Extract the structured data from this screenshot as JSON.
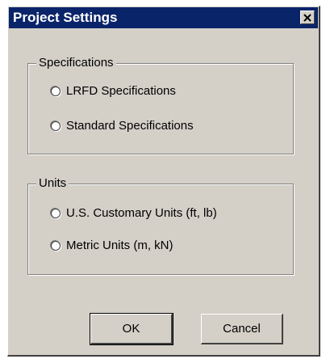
{
  "dialog": {
    "title": "Project Settings",
    "close_icon": "close-x-icon"
  },
  "specifications": {
    "label": "Specifications",
    "options": [
      "LRFD Specifications",
      "Standard Specifications"
    ]
  },
  "units": {
    "label": "Units",
    "options": [
      "U.S. Customary Units (ft, lb)",
      "Metric Units (m, kN)"
    ]
  },
  "buttons": {
    "ok": "OK",
    "cancel": "Cancel"
  },
  "colors": {
    "title_bar": "#0a246a",
    "dialog_face": "#d4d0c8"
  }
}
